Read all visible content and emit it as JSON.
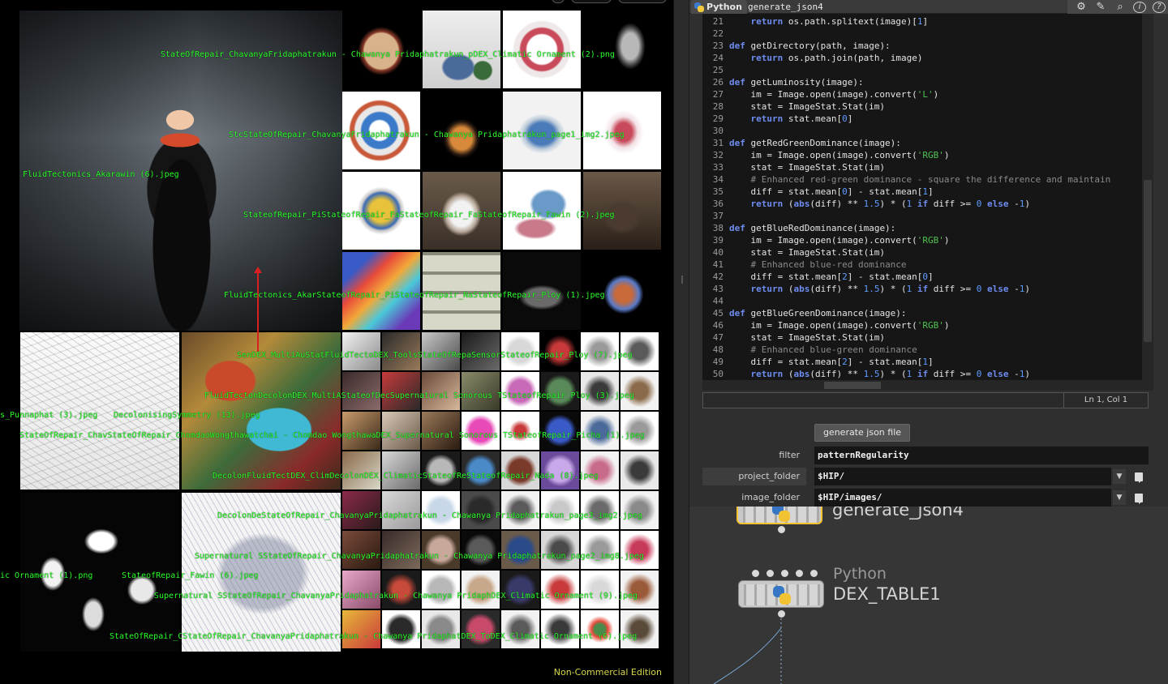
{
  "viewport": {
    "watermark": "Non-Commercial Edition",
    "labels": [
      "StateOfRepair_ChavanyaFridaphatrakun - Chawanya Pridaphatrakun_pDEX_Climatic Ornament  (2).png",
      "StcStateOfRepair_ChavanyaFridaphatrakun - Chawanya Pridaphatrakun_page1_img2.jpeg",
      "FluidTectonics_Akarawin (6).jpeg",
      "StateofRepair_PiStateofRepair_FaStateofRepair_FaStateofRepair_Fawin (2).jpeg",
      "FluidTectonics_AkarStateofRepair_PiStateofRepair_NaStateofRepair_Ploy (1).jpeg",
      "SenDEX_MultiAuStatFluidTectoDEX_ToolsStateOfRepaSensorStateofRepair_Ploy (7).jpeg",
      "FluidTectonDecolonDEX_MultiAStateofDecSupernatural Sonorous TStateofRepair_Ploy (3).jpeg",
      "s_Punnaphat (3).jpeg",
      "DecolonisingSymmetry (13).jpeg",
      "StateOfRepair_ChavStateOfRepair_ChomdaoWongthawatchai - Chomdao WongthawaDEX_Supernatural Sonorous TStateofRepair_Picha (1).jpeg",
      "DecolonFluidTectDEX_ClimDecolonDEX_ClimaticStateofReStateofRepair_Nada (8).jpeg",
      "DecolonDeStateOfRepair_ChavanyaPridaphatrakun - Chawanya Pridaphatrakun_page3_img2.jpeg",
      "Supernatural SStateOfRepair_ChavanyaPridaphatrakun - Chawanya Pridaphatrakun_page2_img8.jpeg",
      "ic Ornament  (1).png",
      "StateofRepair_Fawin (6).jpeg",
      "Supernatural SStateOfRepair_ChavanyaPridaphatrakun - Chawanya PridaphDEX_Climatic Ornament  (9).jpeg",
      "StateOfRepair_CStateOfRepair_ChavanyaPridaphatrakun - Chawanya PridaphatDEX_ToDEX_Climatic Ornament  (6).jpeg"
    ]
  },
  "editor": {
    "tab_label": "Python",
    "node_name": "generate_json4",
    "icons": [
      "gear-icon",
      "brush-icon",
      "search-icon",
      "info-icon",
      "help-icon"
    ],
    "status": "Ln 1, Col 1"
  },
  "parameters": {
    "button_label": "generate json file",
    "filter_label": "filter",
    "filter_value": "patternRegularity",
    "project_folder_label": "project_folder",
    "project_folder_value": "$HIP/",
    "image_folder_label": "image_folder",
    "image_folder_value": "$HIP/images/"
  },
  "network": {
    "node1_title": "generate_json4",
    "node2_type": "Python",
    "node2_title": "DEX_TABLE1"
  },
  "code_lines": [
    {
      "n": "21",
      "t": [
        [
          "",
          "    "
        ],
        [
          "k",
          "return"
        ],
        [
          "",
          " os.path.splitext(image)["
        ],
        [
          "n",
          "1"
        ],
        [
          "",
          "]"
        ]
      ]
    },
    {
      "n": "22",
      "t": []
    },
    {
      "n": "23",
      "t": [
        [
          "k",
          "def"
        ],
        [
          "",
          " getDirectory(path, image):"
        ]
      ]
    },
    {
      "n": "24",
      "t": [
        [
          "",
          "    "
        ],
        [
          "k",
          "return"
        ],
        [
          "",
          " os.path.join(path, image)"
        ]
      ]
    },
    {
      "n": "25",
      "t": []
    },
    {
      "n": "26",
      "t": [
        [
          "k",
          "def"
        ],
        [
          "",
          " getLuminosity(image):"
        ]
      ]
    },
    {
      "n": "27",
      "t": [
        [
          "",
          "    im = Image.open(image).convert("
        ],
        [
          "s",
          "'L'"
        ],
        [
          "",
          ")"
        ]
      ]
    },
    {
      "n": "28",
      "t": [
        [
          "",
          "    stat = ImageStat.Stat(im)"
        ]
      ]
    },
    {
      "n": "29",
      "t": [
        [
          "",
          "    "
        ],
        [
          "k",
          "return"
        ],
        [
          "",
          " stat.mean["
        ],
        [
          "n",
          "0"
        ],
        [
          "",
          "]"
        ]
      ]
    },
    {
      "n": "30",
      "t": []
    },
    {
      "n": "31",
      "t": [
        [
          "k",
          "def"
        ],
        [
          "",
          " getRedGreenDominance(image):"
        ]
      ]
    },
    {
      "n": "32",
      "t": [
        [
          "",
          "    im = Image.open(image).convert("
        ],
        [
          "s",
          "'RGB'"
        ],
        [
          "",
          ")"
        ]
      ]
    },
    {
      "n": "33",
      "t": [
        [
          "",
          "    stat = ImageStat.Stat(im)"
        ]
      ]
    },
    {
      "n": "34",
      "t": [
        [
          "",
          "    "
        ],
        [
          "c",
          "# Enhanced red-green dominance - square the difference and maintain"
        ]
      ]
    },
    {
      "n": "35",
      "t": [
        [
          "",
          "    diff = stat.mean["
        ],
        [
          "n",
          "0"
        ],
        [
          "",
          "] - stat.mean["
        ],
        [
          "n",
          "1"
        ],
        [
          "",
          "]"
        ]
      ]
    },
    {
      "n": "36",
      "t": [
        [
          "",
          "    "
        ],
        [
          "k",
          "return"
        ],
        [
          "",
          " ("
        ],
        [
          "k",
          "abs"
        ],
        [
          "",
          "(diff) ** "
        ],
        [
          "n",
          "1.5"
        ],
        [
          "",
          ") * ("
        ],
        [
          "n",
          "1"
        ],
        [
          "",
          " "
        ],
        [
          "k",
          "if"
        ],
        [
          "",
          " diff >= "
        ],
        [
          "n",
          "0"
        ],
        [
          "",
          " "
        ],
        [
          "k",
          "else"
        ],
        [
          "",
          " -"
        ],
        [
          "n",
          "1"
        ],
        [
          "",
          ")"
        ]
      ]
    },
    {
      "n": "37",
      "t": []
    },
    {
      "n": "38",
      "t": [
        [
          "k",
          "def"
        ],
        [
          "",
          " getBlueRedDominance(image):"
        ]
      ]
    },
    {
      "n": "39",
      "t": [
        [
          "",
          "    im = Image.open(image).convert("
        ],
        [
          "s",
          "'RGB'"
        ],
        [
          "",
          ")"
        ]
      ]
    },
    {
      "n": "40",
      "t": [
        [
          "",
          "    stat = ImageStat.Stat(im)"
        ]
      ]
    },
    {
      "n": "41",
      "t": [
        [
          "",
          "    "
        ],
        [
          "c",
          "# Enhanced blue-red dominance"
        ]
      ]
    },
    {
      "n": "42",
      "t": [
        [
          "",
          "    diff = stat.mean["
        ],
        [
          "n",
          "2"
        ],
        [
          "",
          "] - stat.mean["
        ],
        [
          "n",
          "0"
        ],
        [
          "",
          "]"
        ]
      ]
    },
    {
      "n": "43",
      "t": [
        [
          "",
          "    "
        ],
        [
          "k",
          "return"
        ],
        [
          "",
          " ("
        ],
        [
          "k",
          "abs"
        ],
        [
          "",
          "(diff) ** "
        ],
        [
          "n",
          "1.5"
        ],
        [
          "",
          ") * ("
        ],
        [
          "n",
          "1"
        ],
        [
          "",
          " "
        ],
        [
          "k",
          "if"
        ],
        [
          "",
          " diff >= "
        ],
        [
          "n",
          "0"
        ],
        [
          "",
          " "
        ],
        [
          "k",
          "else"
        ],
        [
          "",
          " -"
        ],
        [
          "n",
          "1"
        ],
        [
          "",
          ")"
        ]
      ]
    },
    {
      "n": "44",
      "t": []
    },
    {
      "n": "45",
      "t": [
        [
          "k",
          "def"
        ],
        [
          "",
          " getBlueGreenDominance(image):"
        ]
      ]
    },
    {
      "n": "46",
      "t": [
        [
          "",
          "    im = Image.open(image).convert("
        ],
        [
          "s",
          "'RGB'"
        ],
        [
          "",
          ")"
        ]
      ]
    },
    {
      "n": "47",
      "t": [
        [
          "",
          "    stat = ImageStat.Stat(im)"
        ]
      ]
    },
    {
      "n": "48",
      "t": [
        [
          "",
          "    "
        ],
        [
          "c",
          "# Enhanced blue-green dominance"
        ]
      ]
    },
    {
      "n": "49",
      "t": [
        [
          "",
          "    diff = stat.mean["
        ],
        [
          "n",
          "2"
        ],
        [
          "",
          "] - stat.mean["
        ],
        [
          "n",
          "1"
        ],
        [
          "",
          "]"
        ]
      ]
    },
    {
      "n": "50",
      "t": [
        [
          "",
          "    "
        ],
        [
          "k",
          "return"
        ],
        [
          "",
          " ("
        ],
        [
          "k",
          "abs"
        ],
        [
          "",
          "(diff) ** "
        ],
        [
          "n",
          "1.5"
        ],
        [
          "",
          ") * ("
        ],
        [
          "n",
          "1"
        ],
        [
          "",
          " "
        ],
        [
          "k",
          "if"
        ],
        [
          "",
          " diff >= "
        ],
        [
          "n",
          "0"
        ],
        [
          "",
          " "
        ],
        [
          "k",
          "else"
        ],
        [
          "",
          " -"
        ],
        [
          "n",
          "1"
        ],
        [
          "",
          ")"
        ]
      ]
    }
  ]
}
